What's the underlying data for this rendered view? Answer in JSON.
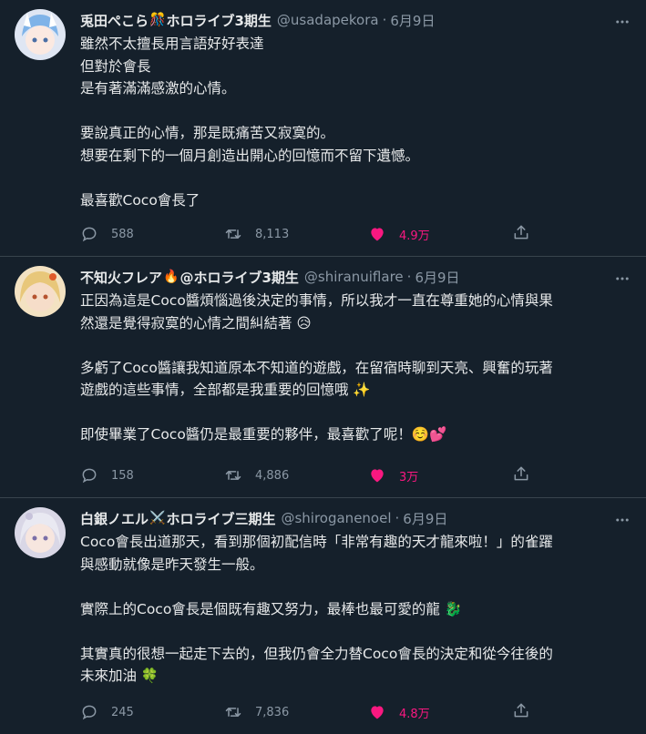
{
  "tweets": [
    {
      "display_name": "兎田ぺこら",
      "badge": "🎊",
      "group": "ホロライブ3期生",
      "handle": "@usadapekora",
      "separator": "·",
      "date": "6月9日",
      "lines": [
        "雖然不太擅長用言語好好表達",
        "但對於會長",
        "是有著滿滿感激的心情。",
        "",
        "要說真正的心情，那是既痛苦又寂寞的。",
        "想要在剩下的一個月創造出開心的回憶而不留下遺憾。",
        "",
        "最喜歡Coco會長了"
      ],
      "replies": "588",
      "retweets": "8,113",
      "likes": "4.9万",
      "avatar_color": "#dfe6f3"
    },
    {
      "display_name": "不知火フレア",
      "badge": "🔥",
      "group": "@ホロライブ3期生",
      "handle": "@shiranuiflare",
      "separator": "·",
      "date": "6月9日",
      "lines": [
        "正因為這是Coco醬煩惱過後決定的事情，所以我才一直在尊重她的心情與果",
        "然還是覺得寂寞的心情之間糾結著 😥",
        "",
        "多虧了Coco醬讓我知道原本不知道的遊戲，在留宿時聊到天亮、興奮的玩著",
        "遊戲的這些事情，全部都是我重要的回憶哦 ✨",
        "",
        "即使畢業了Coco醬仍是最重要的夥伴，最喜歡了呢！☺️💕"
      ],
      "replies": "158",
      "retweets": "4,886",
      "likes": "3万",
      "avatar_color": "#e8c77a"
    },
    {
      "display_name": "白銀ノエル",
      "badge": "⚔️",
      "group": "ホロライブ三期生",
      "handle": "@shiroganenoel",
      "separator": "·",
      "date": "6月9日",
      "lines": [
        "Coco會長出道那天，看到那個初配信時「非常有趣的天才龍來啦！」的雀躍",
        "與感動就像是昨天發生一般。",
        "",
        "實際上的Coco會長是個既有趣又努力，最棒也最可愛的龍 🐉",
        "",
        "其實真的很想一起走下去的，但我仍會全力替Coco會長的決定和從今往後的",
        "未來加油 🍀"
      ],
      "replies": "245",
      "retweets": "7,836",
      "likes": "4.8万",
      "avatar_color": "#d9d7e6"
    }
  ],
  "colors": {
    "background": "#15202b",
    "divider": "#38444d",
    "muted": "#8b98a5",
    "like": "#f91880"
  }
}
